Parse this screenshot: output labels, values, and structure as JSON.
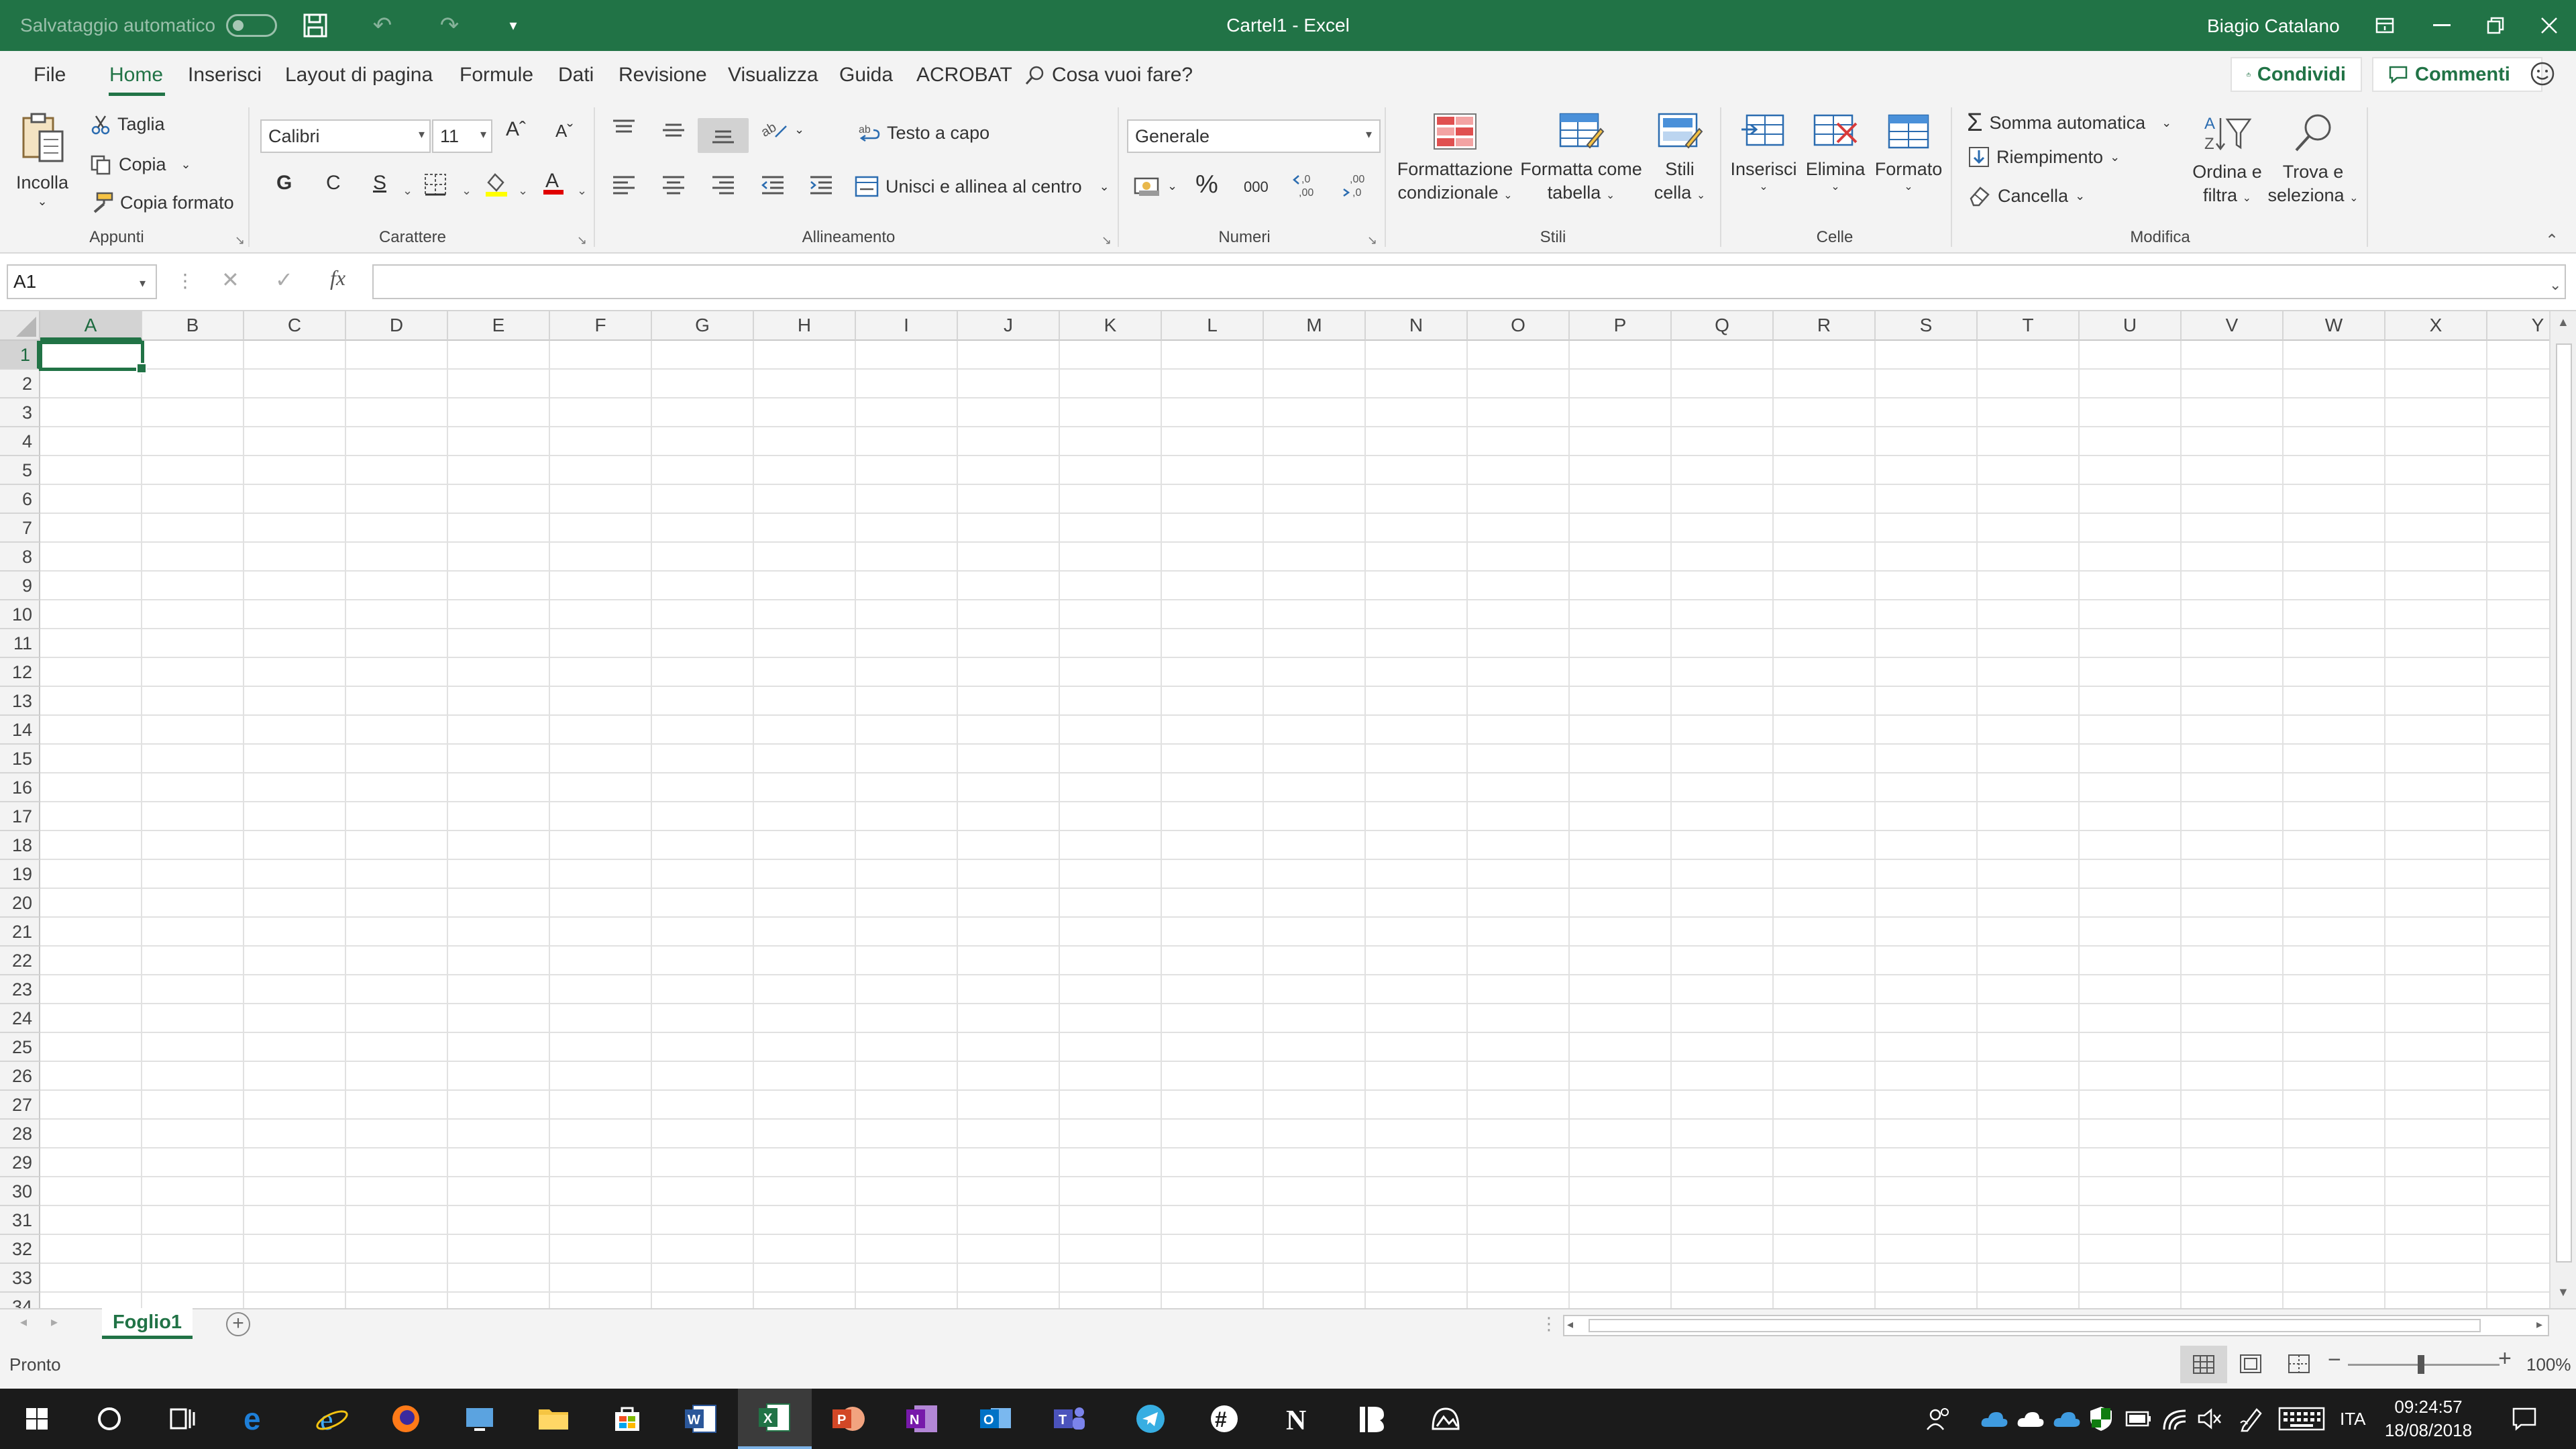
{
  "titlebar": {
    "autosave_label": "Salvataggio automatico",
    "title": "Cartel1  -  Excel",
    "user": "Biagio Catalano"
  },
  "ribbon_tabs": [
    "File",
    "Home",
    "Inserisci",
    "Layout di pagina",
    "Formule",
    "Dati",
    "Revisione",
    "Visualizza",
    "Guida",
    "ACROBAT"
  ],
  "active_tab": "Home",
  "tell_me": "Cosa vuoi fare?",
  "share_label": "Condividi",
  "comments_label": "Commenti",
  "clipboard": {
    "paste": "Incolla",
    "cut": "Taglia",
    "copy": "Copia",
    "format_painter": "Copia formato",
    "label": "Appunti"
  },
  "font": {
    "name": "Calibri",
    "size": "11",
    "bold": "G",
    "italic": "C",
    "underline": "S",
    "label": "Carattere"
  },
  "alignment": {
    "wrap_text": "Testo a capo",
    "merge_center": "Unisci e allinea al centro",
    "label": "Allineamento"
  },
  "number": {
    "format": "Generale",
    "label": "Numeri"
  },
  "styles": {
    "conditional_1": "Formattazione",
    "conditional_2": "condizionale",
    "table_1": "Formatta come",
    "table_2": "tabella",
    "cell_1": "Stili",
    "cell_2": "cella",
    "label": "Stili"
  },
  "cells": {
    "insert": "Inserisci",
    "delete": "Elimina",
    "format": "Formato",
    "label": "Celle"
  },
  "editing": {
    "autosum": "Somma automatica",
    "fill": "Riempimento",
    "clear": "Cancella",
    "sort_1": "Ordina e",
    "sort_2": "filtra",
    "find_1": "Trova e",
    "find_2": "seleziona",
    "label": "Modifica"
  },
  "formula_bar": {
    "name_box": "A1",
    "fx": "fx",
    "value": ""
  },
  "columns": [
    "A",
    "B",
    "C",
    "D",
    "E",
    "F",
    "G",
    "H",
    "I",
    "J",
    "K",
    "L",
    "M",
    "N",
    "O",
    "P",
    "Q",
    "R",
    "S",
    "T",
    "U",
    "V",
    "W",
    "X",
    "Y"
  ],
  "rows": [
    "1",
    "2",
    "3",
    "4",
    "5",
    "6",
    "7",
    "8",
    "9",
    "10",
    "11",
    "12",
    "13",
    "14",
    "15",
    "16",
    "17",
    "18",
    "19",
    "20",
    "21",
    "22",
    "23",
    "24",
    "25",
    "26",
    "27",
    "28",
    "29",
    "30",
    "31",
    "32",
    "33",
    "34"
  ],
  "selected_cell": "A1",
  "sheet_tab": "Foglio1",
  "status": {
    "ready": "Pronto",
    "zoom": "100%"
  },
  "taskbar": {
    "language": "ITA",
    "time": "09:24:57",
    "date": "18/08/2018"
  },
  "colors": {
    "excel_green": "#217346",
    "ribbon_bg": "#f3f3f3",
    "taskbar_bg": "#1b1b1b"
  }
}
